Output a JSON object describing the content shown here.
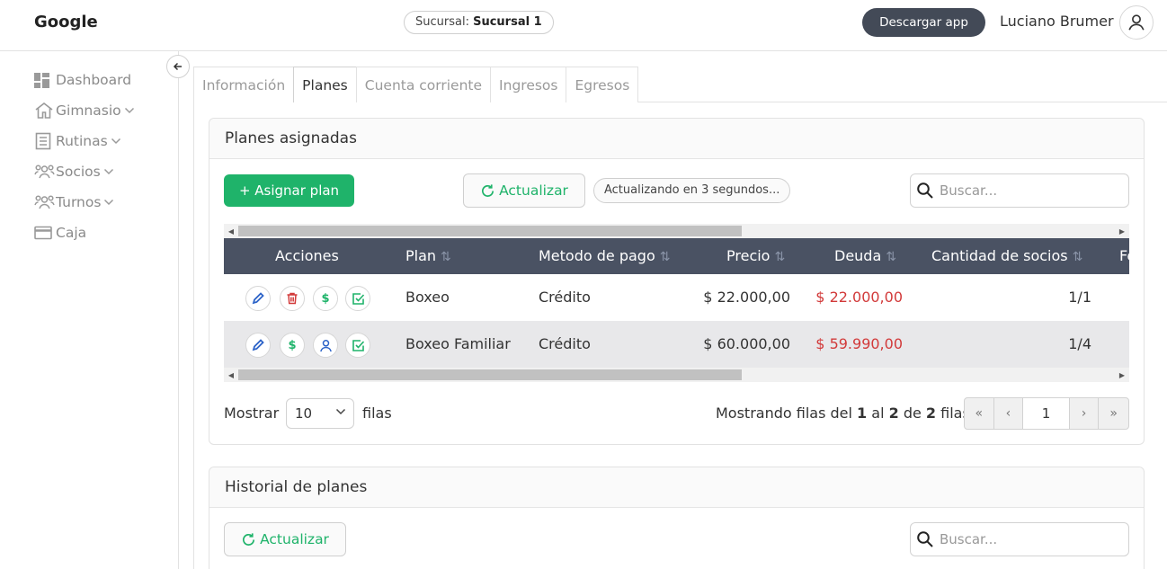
{
  "header": {
    "brand": "Google",
    "branch_label": "Sucursal: ",
    "branch_value": "Sucursal 1",
    "download_label": "Descargar app",
    "user_name": "Luciano Brumer"
  },
  "sidebar": {
    "items": [
      {
        "label": "Dashboard",
        "icon": "dashboard-icon",
        "has_chevron": false
      },
      {
        "label": "Gimnasio",
        "icon": "home-icon",
        "has_chevron": true
      },
      {
        "label": "Rutinas",
        "icon": "document-icon",
        "has_chevron": true
      },
      {
        "label": "Socios",
        "icon": "users-icon",
        "has_chevron": true
      },
      {
        "label": "Turnos",
        "icon": "users-icon",
        "has_chevron": true
      },
      {
        "label": "Caja",
        "icon": "card-icon",
        "has_chevron": false
      }
    ]
  },
  "tabs": [
    {
      "label": "Información",
      "active": false
    },
    {
      "label": "Planes",
      "active": true
    },
    {
      "label": "Cuenta corriente",
      "active": false
    },
    {
      "label": "Ingresos",
      "active": false
    },
    {
      "label": "Egresos",
      "active": false
    }
  ],
  "assigned": {
    "title": "Planes asignadas",
    "assign_label": "+ Asignar plan",
    "refresh_label": "Actualizar",
    "status_text": "Actualizando en 3 segundos...",
    "search_placeholder": "Buscar...",
    "columns": [
      "Acciones",
      "Plan",
      "Metodo de pago",
      "Precio",
      "Deuda",
      "Cantidad de socios",
      "Fe"
    ],
    "rows": [
      {
        "plan": "Boxeo",
        "payment": "Crédito",
        "price": "$ 22.000,00",
        "debt": "$ 22.000,00",
        "members": "1/1",
        "actions": [
          "edit",
          "delete",
          "pay",
          "check"
        ]
      },
      {
        "plan": "Boxeo Familiar",
        "payment": "Crédito",
        "price": "$ 60.000,00",
        "debt": "$ 59.990,00",
        "members": "1/4",
        "actions": [
          "edit",
          "pay",
          "user",
          "check"
        ]
      }
    ],
    "show_label": "Mostrar",
    "rows_value": "10",
    "rows_label": "filas",
    "range_pre": "Mostrando filas del ",
    "range_from": "1",
    "range_mid1": " al ",
    "range_to": "2",
    "range_mid2": " de ",
    "range_total": "2",
    "range_post": " filas",
    "page": "1"
  },
  "history": {
    "title": "Historial de planes",
    "refresh_label": "Actualizar",
    "search_placeholder": "Buscar..."
  },
  "colors": {
    "accent": "#1fb36a",
    "table_header": "#4a5263",
    "debt": "#d23a3a",
    "download_button": "#434a57"
  }
}
